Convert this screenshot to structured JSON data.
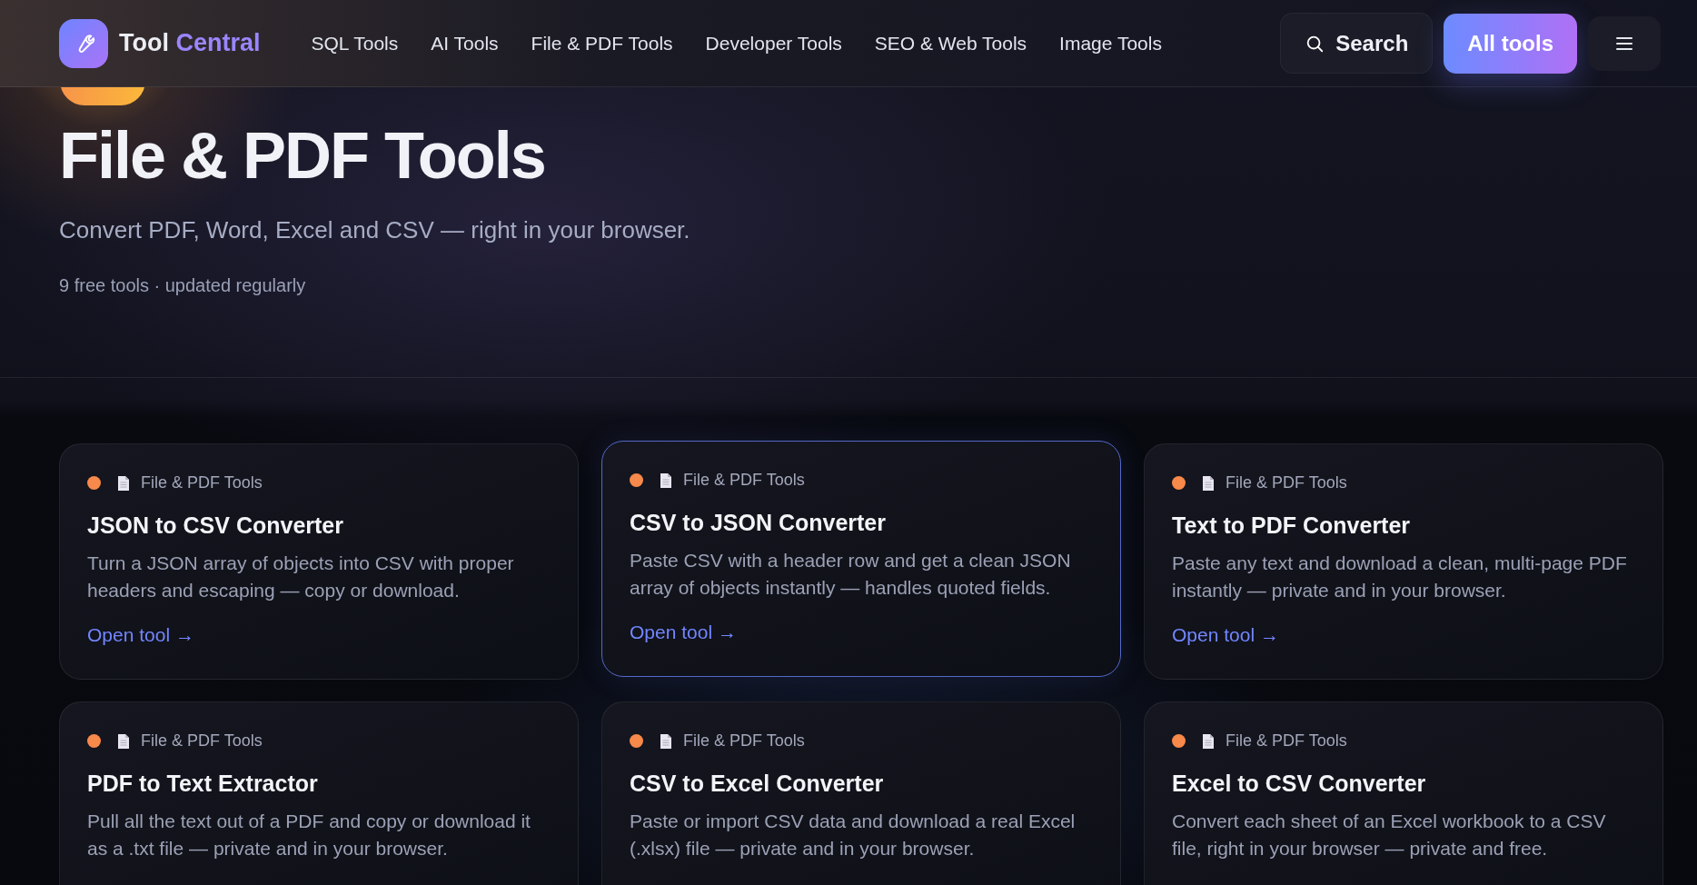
{
  "header": {
    "logo": {
      "word_1": "Tool",
      "word_2": "Central"
    },
    "nav": [
      {
        "label": "SQL Tools"
      },
      {
        "label": "AI Tools"
      },
      {
        "label": "File & PDF Tools"
      },
      {
        "label": "Developer Tools"
      },
      {
        "label": "SEO & Web Tools"
      },
      {
        "label": "Image Tools"
      }
    ],
    "search_button": "Search",
    "all_tools_button": "All tools"
  },
  "hero": {
    "title": "File & PDF Tools",
    "subtitle": "Convert PDF, Word, Excel and CSV — right in your browser.",
    "meta": "9 free tools · updated regularly"
  },
  "cards": [
    {
      "category": "File & PDF Tools",
      "color": "#f7894a",
      "title": "JSON to CSV Converter",
      "description": "Turn a JSON array of objects into CSV with proper headers and escaping — copy or download.",
      "link": "Open tool →",
      "highlighted": false
    },
    {
      "category": "File & PDF Tools",
      "color": "#f7894a",
      "title": "CSV to JSON Converter",
      "description": "Paste CSV with a header row and get a clean JSON array of objects instantly — handles quoted fields.",
      "link": "Open tool →",
      "highlighted": true
    },
    {
      "category": "File & PDF Tools",
      "color": "#f7894a",
      "title": "Text to PDF Converter",
      "description": "Paste any text and download a clean, multi-page PDF instantly — private and in your browser.",
      "link": "Open tool →",
      "highlighted": false
    },
    {
      "category": "File & PDF Tools",
      "color": "#f7894a",
      "title": "PDF to Text Extractor",
      "description": "Pull all the text out of a PDF and copy or download it as a .txt file — private and in your browser.",
      "highlighted": false
    },
    {
      "category": "File & PDF Tools",
      "color": "#f7894a",
      "title": "CSV to Excel Converter",
      "description": "Paste or import CSV data and download a real Excel (.xlsx) file — private and in your browser.",
      "highlighted": false
    },
    {
      "category": "File & PDF Tools",
      "color": "#f7894a",
      "title": "Excel to CSV Converter",
      "description": "Convert each sheet of an Excel workbook to a CSV file, right in your browser — private and free.",
      "highlighted": false
    }
  ]
}
